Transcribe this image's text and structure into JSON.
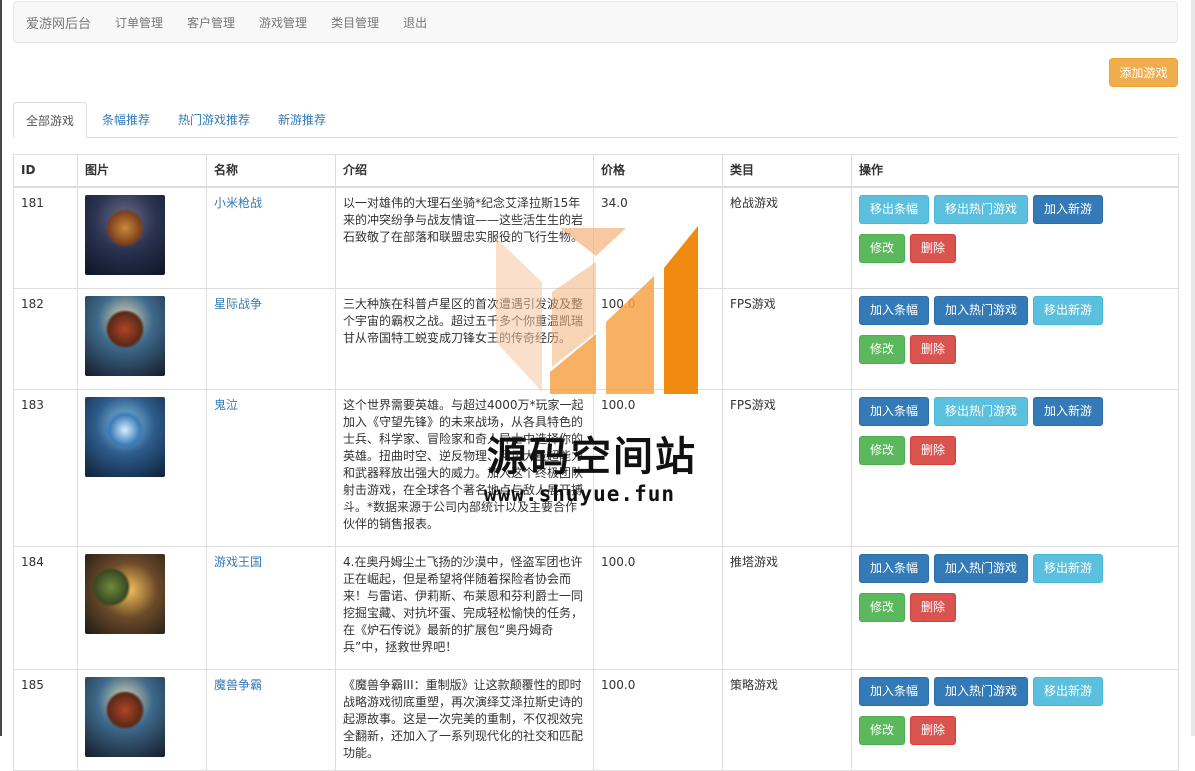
{
  "nav": {
    "brand": "爱游网后台",
    "links": [
      "订单管理",
      "客户管理",
      "游戏管理",
      "类目管理",
      "退出"
    ]
  },
  "toolbar": {
    "add_game_label": "添加游戏"
  },
  "tabs": [
    {
      "label": "全部游戏",
      "active": true
    },
    {
      "label": "条幅推荐",
      "active": false
    },
    {
      "label": "热门游戏推荐",
      "active": false
    },
    {
      "label": "新游推荐",
      "active": false
    }
  ],
  "table": {
    "headers": [
      "ID",
      "图片",
      "名称",
      "介绍",
      "价格",
      "类目",
      "操作"
    ],
    "rows": [
      {
        "id": "181",
        "name": "小米枪战",
        "desc": "以一对雄伟的大理石坐骑*纪念艾泽拉斯15年来的冲突纷争与战友情谊——这些活生生的岩石致敬了在部落和联盟忠实服役的飞行生物。",
        "price": "34.0",
        "category": "枪战游戏",
        "banner_btn": "移出条幅",
        "hot_btn": "移出热门游戏",
        "new_btn": "加入新游",
        "edit": "修改",
        "delete": "删除"
      },
      {
        "id": "182",
        "name": "星际战争",
        "desc": "三大种族在科普卢星区的首次遭遇引发波及整个宇宙的霸权之战。超过五千多个你重温凯瑞甘从帝国特工蜕变成刀锋女王的传奇经历。",
        "price": "100.0",
        "category": "FPS游戏",
        "banner_btn": "加入条幅",
        "hot_btn": "加入热门游戏",
        "new_btn": "移出新游",
        "edit": "修改",
        "delete": "删除"
      },
      {
        "id": "183",
        "name": "鬼泣",
        "desc": "这个世界需要英雄。与超过4000万*玩家一起加入《守望先锋》的未来战场，从各具特色的士兵、科学家、冒险家和奇人异士中选择你的英雄。扭曲时空、逆反物理、利用大量超能力和武器释放出强大的威力。加入这个终极团队射击游戏，在全球各个著名地点与敌人展开搏斗。*数据来源于公司内部统计以及主要合作伙伴的销售报表。",
        "price": "100.0",
        "category": "FPS游戏",
        "banner_btn": "加入条幅",
        "hot_btn": "移出热门游戏",
        "new_btn": "加入新游",
        "edit": "修改",
        "delete": "删除"
      },
      {
        "id": "184",
        "name": "游戏王国",
        "desc": "4.在奥丹姆尘土飞扬的沙漠中，怪盗军团也许正在崛起，但是希望将伴随着探险者协会而来！与雷诺、伊莉斯、布莱恩和芬利爵士一同挖掘宝藏、对抗坏蛋、完成轻松愉快的任务，在《炉石传说》最新的扩展包“奥丹姆奇兵”中，拯救世界吧！",
        "price": "100.0",
        "category": "推塔游戏",
        "banner_btn": "加入条幅",
        "hot_btn": "加入热门游戏",
        "new_btn": "移出新游",
        "edit": "修改",
        "delete": "删除"
      },
      {
        "id": "185",
        "name": "魔兽争霸",
        "desc": "《魔兽争霸III：重制版》让这款颠覆性的即时战略游戏彻底重塑，再次演绎艾泽拉斯史诗的起源故事。这是一次完美的重制，不仅视效完全翻新，还加入了一系列现代化的社交和匹配功能。",
        "price": "100.0",
        "category": "策略游戏",
        "banner_btn": "加入条幅",
        "hot_btn": "加入热门游戏",
        "new_btn": "移出新游",
        "edit": "修改",
        "delete": "删除"
      }
    ]
  },
  "watermark": {
    "title": "源码空间站",
    "url": "www.shuyue.fun"
  }
}
